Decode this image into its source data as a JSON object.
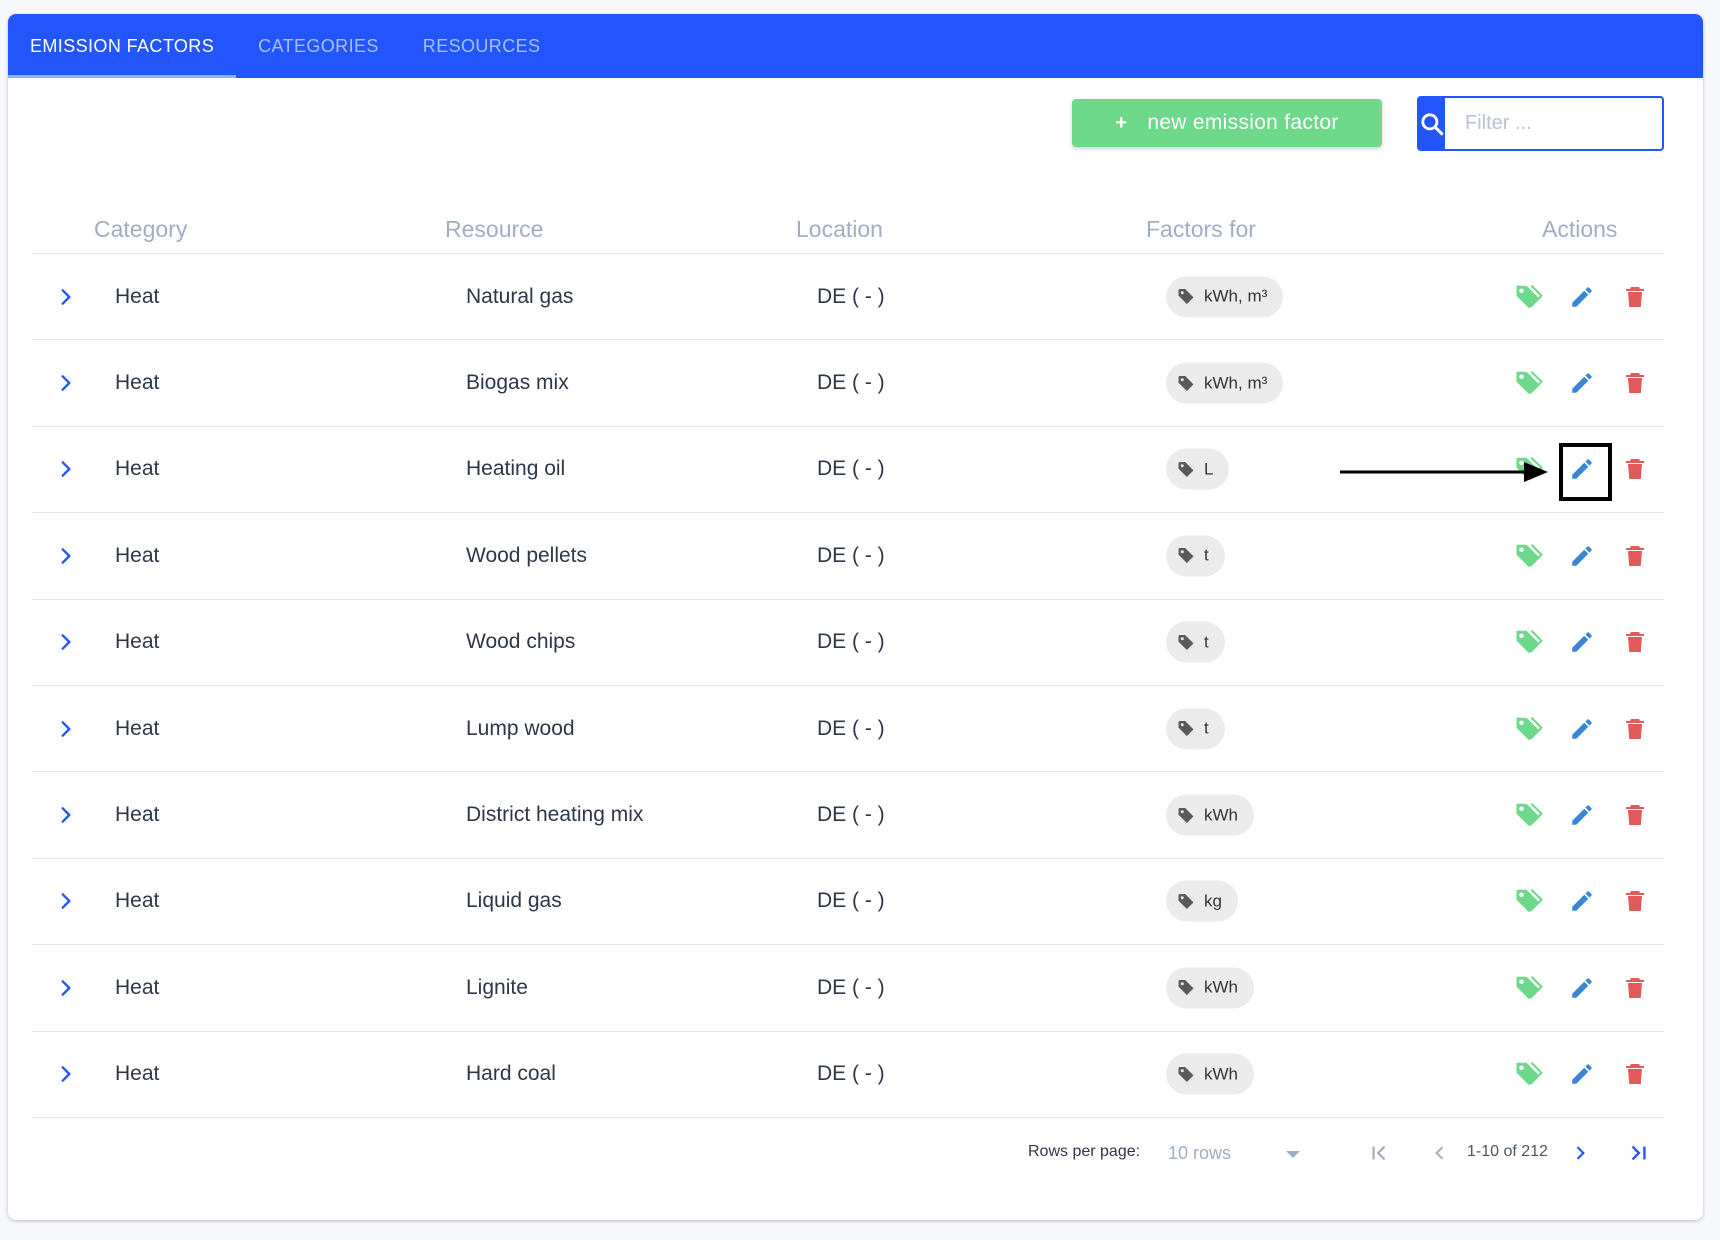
{
  "tabs": [
    {
      "label": "EMISSION FACTORS",
      "active": true
    },
    {
      "label": "CATEGORIES",
      "active": false
    },
    {
      "label": "RESOURCES",
      "active": false
    }
  ],
  "toolbar": {
    "new_button_icon": "+",
    "new_button_label": "new emission factor",
    "filter_placeholder": "Filter ..."
  },
  "table": {
    "headers": {
      "category": "Category",
      "resource": "Resource",
      "location": "Location",
      "factors_for": "Factors for",
      "actions": "Actions"
    },
    "rows": [
      {
        "category": "Heat",
        "resource": "Natural gas",
        "location": "DE ( - )",
        "factors_for": "kWh, m³"
      },
      {
        "category": "Heat",
        "resource": "Biogas mix",
        "location": "DE ( - )",
        "factors_for": "kWh, m³"
      },
      {
        "category": "Heat",
        "resource": "Heating oil",
        "location": "DE ( - )",
        "factors_for": "L"
      },
      {
        "category": "Heat",
        "resource": "Wood pellets",
        "location": "DE ( - )",
        "factors_for": "t"
      },
      {
        "category": "Heat",
        "resource": "Wood chips",
        "location": "DE ( - )",
        "factors_for": "t"
      },
      {
        "category": "Heat",
        "resource": "Lump wood",
        "location": "DE ( - )",
        "factors_for": "t"
      },
      {
        "category": "Heat",
        "resource": "District heating mix",
        "location": "DE ( - )",
        "factors_for": "kWh"
      },
      {
        "category": "Heat",
        "resource": "Liquid gas",
        "location": "DE ( - )",
        "factors_for": "kg"
      },
      {
        "category": "Heat",
        "resource": "Lignite",
        "location": "DE ( - )",
        "factors_for": "kWh"
      },
      {
        "category": "Heat",
        "resource": "Hard coal",
        "location": "DE ( - )",
        "factors_for": "kWh"
      }
    ]
  },
  "pagination": {
    "rows_per_page_label": "Rows per page:",
    "rows_per_page_value": "10 rows",
    "range_text": "1-10 of 212"
  },
  "annotation": {
    "highlighted_row_index": 2,
    "highlighted_action": "edit"
  },
  "colors": {
    "primary": "#2255fa",
    "success": "#6ed88b",
    "edit": "#3a86d4",
    "delete": "#e45a5a",
    "chip_bg": "#ebebeb"
  },
  "icons": {
    "search": "search-icon",
    "expand": "chevron-right-icon",
    "chip": "tag-icon",
    "action_tag": "tag-icon",
    "action_edit": "pencil-icon",
    "action_delete": "trash-icon",
    "first_page": "first-page-icon",
    "prev_page": "chevron-left-icon",
    "next_page": "chevron-right-icon",
    "last_page": "last-page-icon"
  }
}
